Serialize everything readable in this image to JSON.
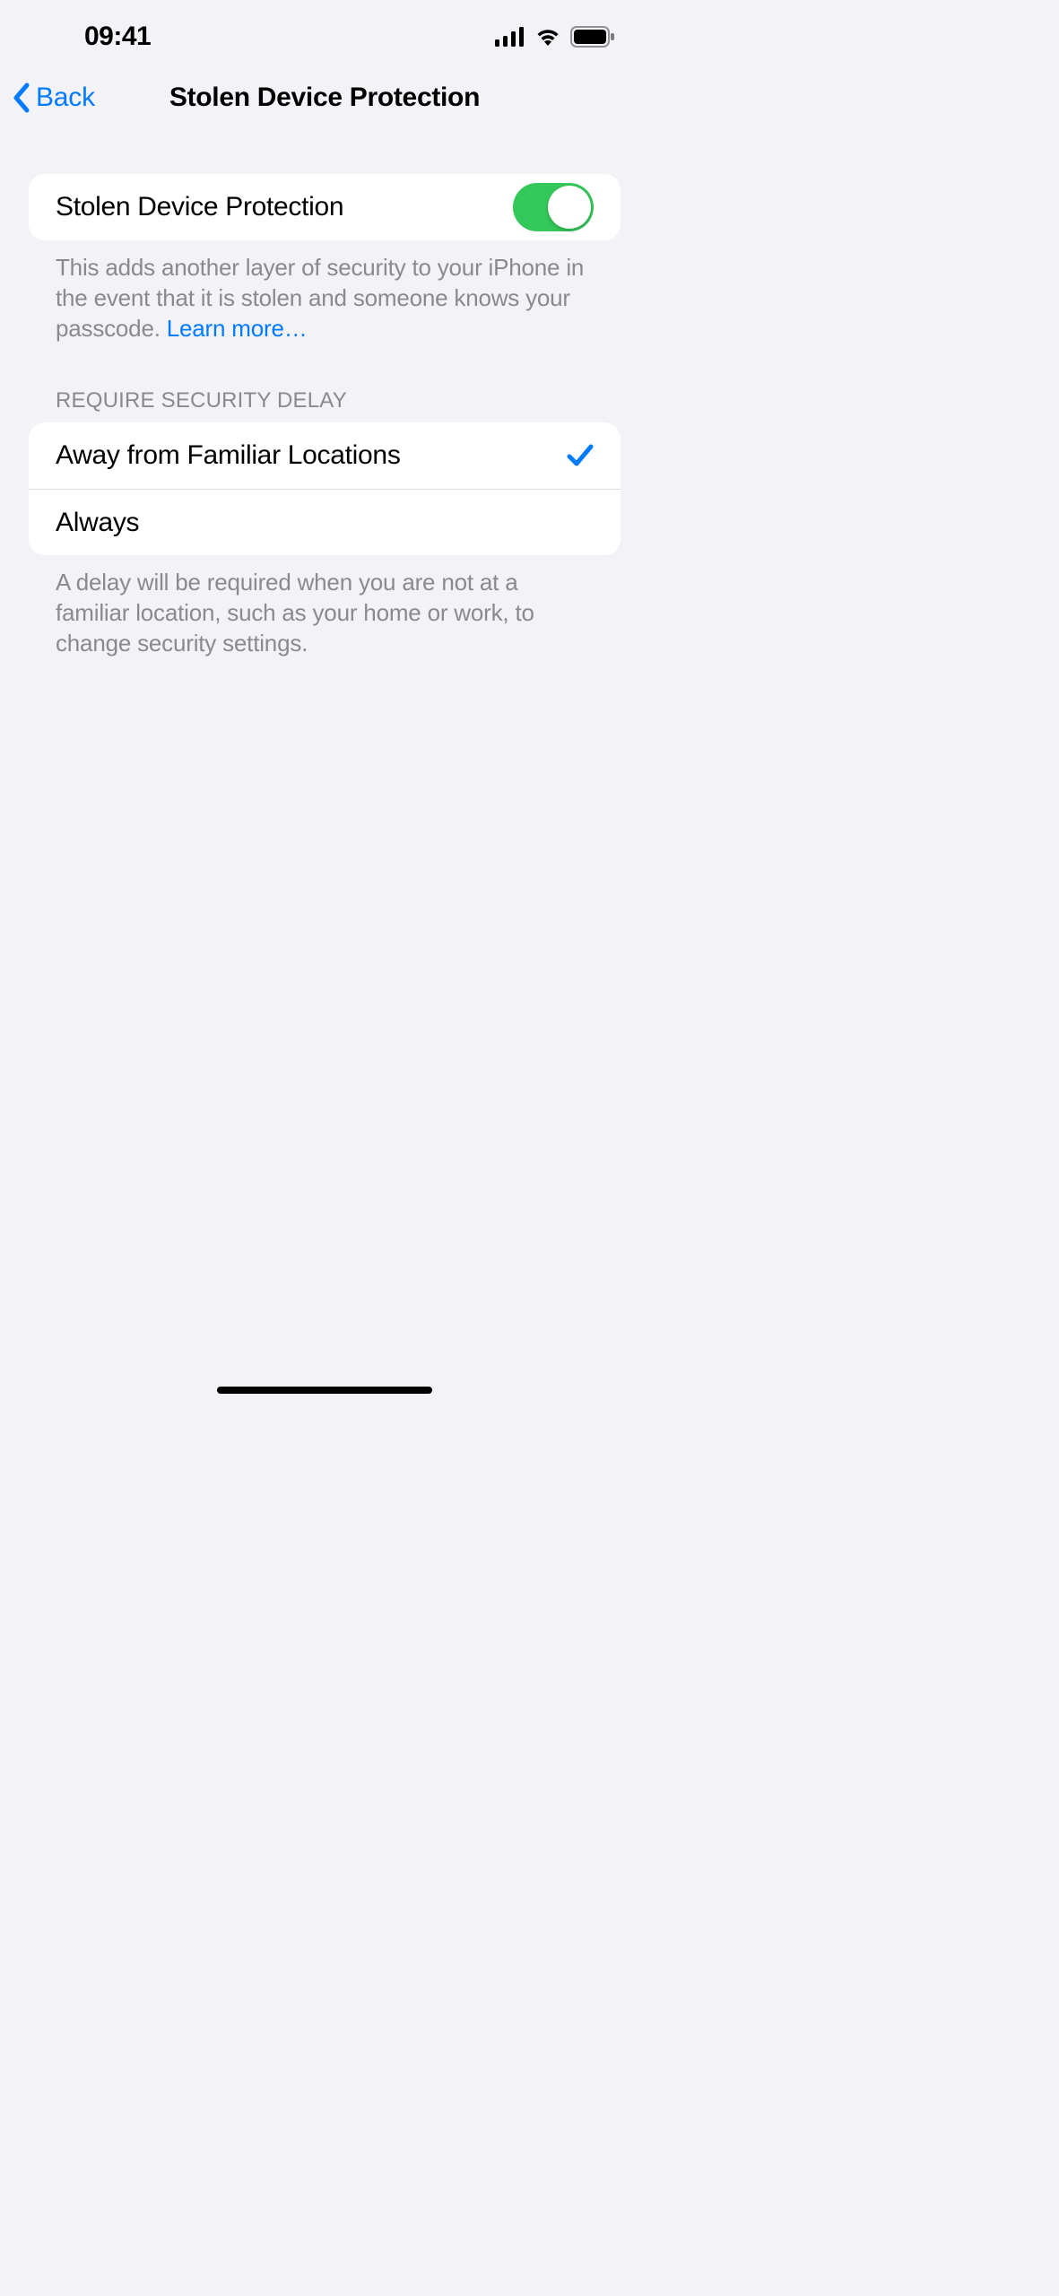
{
  "status": {
    "time": "09:41"
  },
  "nav": {
    "back_label": "Back",
    "title": "Stolen Device Protection"
  },
  "toggle_row": {
    "label": "Stolen Device Protection",
    "enabled": true
  },
  "toggle_footer": {
    "text": "This adds another layer of security to your iPhone in the event that it is stolen and someone knows your passcode. ",
    "link_text": "Learn more…"
  },
  "delay_section": {
    "header": "REQUIRE SECURITY DELAY",
    "options": [
      {
        "label": "Away from Familiar Locations",
        "selected": true
      },
      {
        "label": "Always",
        "selected": false
      }
    ],
    "footer": "A delay will be required when you are not at a familiar location, such as your home or work, to change security settings."
  }
}
